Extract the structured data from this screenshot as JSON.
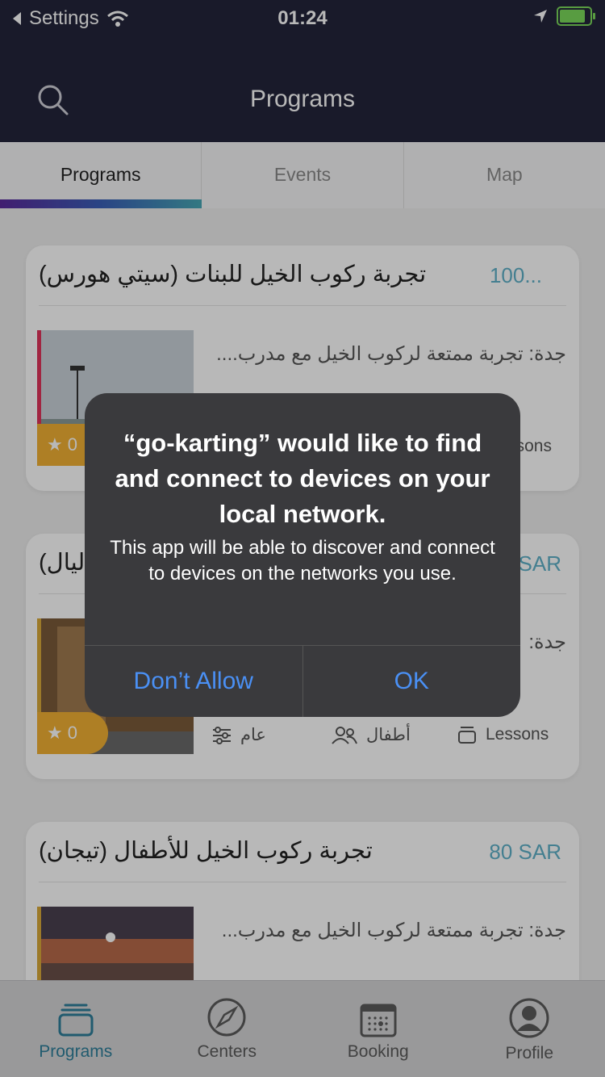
{
  "status_bar": {
    "back_label": "Settings",
    "time": "01:24",
    "battery_level": 0.85
  },
  "nav": {
    "title": "Programs"
  },
  "tabs": [
    {
      "label": "Programs"
    },
    {
      "label": "Events"
    },
    {
      "label": "Map"
    }
  ],
  "cards": [
    {
      "title": "تجربة ركوب الخيل للبنات (سيتي هورس)",
      "price": "100...",
      "desc": "جدة: تجربة ممتعة لركوب الخيل مع مدرب....",
      "rating": "0",
      "meta3": "...sons"
    },
    {
      "title": "...ليال)",
      "price": "SAR",
      "desc": "جدة:",
      "rating": "0",
      "meta1": "عام",
      "meta2": "أطفال",
      "meta3": "Lessons"
    },
    {
      "title": "تجربة ركوب الخيل للأطفال (تيجان)",
      "price": "80 SAR",
      "desc": "جدة: تجربة ممتعة لركوب الخيل مع مدرب..."
    }
  ],
  "alert": {
    "title": "“go-karting” would like to find and connect to devices on your local network.",
    "message": "This app will be able to discover and connect to devices on the networks you use.",
    "deny_label": "Don’t Allow",
    "ok_label": "OK"
  },
  "bottom_nav": [
    {
      "label": "Programs",
      "icon": "basket-icon"
    },
    {
      "label": "Centers",
      "icon": "compass-icon"
    },
    {
      "label": "Booking",
      "icon": "calendar-icon"
    },
    {
      "label": "Profile",
      "icon": "user-icon"
    }
  ],
  "colors": {
    "nav_bg": "#23253b",
    "accent": "#2f7f9a",
    "alert_button": "#4a90f5",
    "rating": "#f2b134"
  }
}
